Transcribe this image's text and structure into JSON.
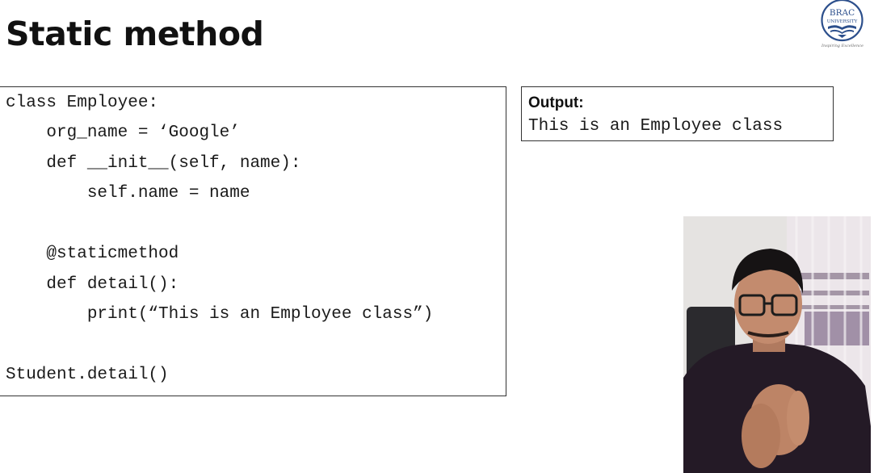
{
  "slide": {
    "title": "Static method"
  },
  "logo": {
    "name_line1": "BRAC",
    "name_line2": "UNIVERSITY",
    "tagline": "Inspiring Excellence"
  },
  "code": {
    "lines": [
      "class Employee:",
      "    org_name = ‘Google’",
      "    def __init__(self, name):",
      "        self.name = name",
      "",
      "    @staticmethod",
      "    def detail():",
      "        print(“This is an Employee class”)",
      "",
      "Student.detail()"
    ]
  },
  "output": {
    "label": "Output:",
    "text": "This is an Employee class"
  },
  "webcam": {
    "icon": "presenter-video-feed"
  },
  "colors": {
    "logo_blue": "#2c4f8c",
    "border": "#333333",
    "text": "#1a1a1a"
  }
}
